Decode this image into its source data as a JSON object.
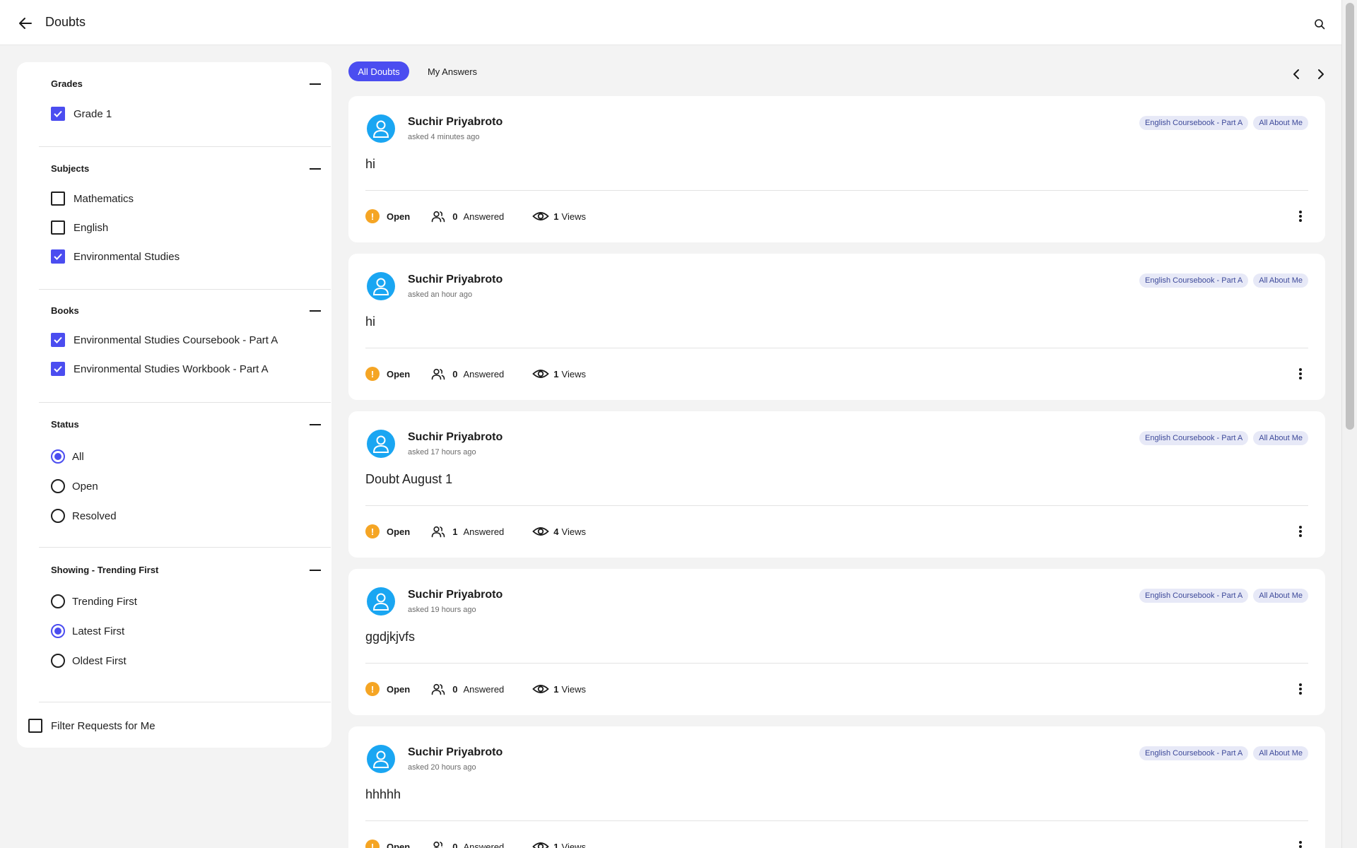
{
  "header": {
    "title": "Doubts"
  },
  "filters": {
    "grades": {
      "title": "Grades",
      "items": [
        {
          "label": "Grade 1",
          "checked": true
        }
      ]
    },
    "subjects": {
      "title": "Subjects",
      "items": [
        {
          "label": "Mathematics",
          "checked": false
        },
        {
          "label": "English",
          "checked": false
        },
        {
          "label": "Environmental Studies",
          "checked": true
        }
      ]
    },
    "books": {
      "title": "Books",
      "items": [
        {
          "label": "Environmental Studies Coursebook - Part A",
          "checked": true
        },
        {
          "label": "Environmental Studies Workbook - Part A",
          "checked": true
        }
      ]
    },
    "status": {
      "title": "Status",
      "selected": "All",
      "options": [
        {
          "label": "All"
        },
        {
          "label": "Open"
        },
        {
          "label": "Resolved"
        }
      ]
    },
    "sort": {
      "title": "Showing - Trending First",
      "selected": "Latest First",
      "options": [
        {
          "label": "Trending First"
        },
        {
          "label": "Latest First"
        },
        {
          "label": "Oldest First"
        }
      ]
    },
    "requests": {
      "label": "Filter Requests for Me",
      "checked": false
    }
  },
  "tabs": [
    {
      "label": "All Doubts",
      "active": true
    },
    {
      "label": "My Answers",
      "active": false
    }
  ],
  "doubts": [
    {
      "author": "Suchir Priyabroto",
      "asked": "asked 4 minutes ago",
      "tags": [
        "English Coursebook - Part A",
        "All About Me"
      ],
      "question": "hi",
      "status": "Open",
      "answered_count": "0",
      "answered_label": "Answered",
      "views_count": "1",
      "views_label": "Views"
    },
    {
      "author": "Suchir Priyabroto",
      "asked": "asked an hour ago",
      "tags": [
        "English Coursebook - Part A",
        "All About Me"
      ],
      "question": "hi",
      "status": "Open",
      "answered_count": "0",
      "answered_label": "Answered",
      "views_count": "1",
      "views_label": "Views"
    },
    {
      "author": "Suchir Priyabroto",
      "asked": "asked 17 hours ago",
      "tags": [
        "English Coursebook - Part A",
        "All About Me"
      ],
      "question": "Doubt August 1",
      "status": "Open",
      "answered_count": "1",
      "answered_label": "Answered",
      "views_count": "4",
      "views_label": "Views"
    },
    {
      "author": "Suchir Priyabroto",
      "asked": "asked 19 hours ago",
      "tags": [
        "English Coursebook - Part A",
        "All About Me"
      ],
      "question": "ggdjkjvfs",
      "status": "Open",
      "answered_count": "0",
      "answered_label": "Answered",
      "views_count": "1",
      "views_label": "Views"
    },
    {
      "author": "Suchir Priyabroto",
      "asked": "asked 20 hours ago",
      "tags": [
        "English Coursebook - Part A",
        "All About Me"
      ],
      "question": "hhhhh",
      "status": "Open",
      "answered_count": "0",
      "answered_label": "Answered",
      "views_count": "1",
      "views_label": "Views"
    }
  ],
  "icons": {
    "back": "arrow-left-icon",
    "search": "search-icon",
    "prev": "chevron-left-icon",
    "next": "chevron-right-icon",
    "status": "exclamation-icon",
    "answered": "users-icon",
    "views": "eye-icon",
    "more": "kebab-icon",
    "avatar": "user-avatar-icon",
    "check": "check-icon"
  },
  "colors": {
    "accent": "#4b4df0",
    "open_status": "#f5a524",
    "avatar": "#1aa6f2",
    "tag_bg": "#e7e9f7",
    "tag_text": "#3e4a9a",
    "background": "#f3f3f3"
  }
}
